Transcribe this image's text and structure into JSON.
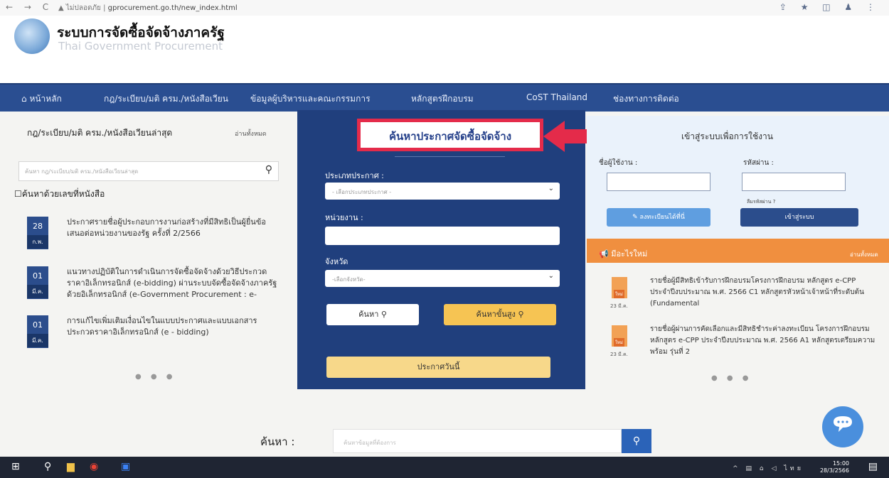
{
  "browser": {
    "nav_glyphs": "← → C",
    "lock_text": "▲ ไม่ปลอดภัย |",
    "url": "gprocurement.go.th/new_index.html",
    "toolbar_glyphs": "⇪ ★ ◫ ♟ ⋮"
  },
  "header": {
    "title": "ระบบการจัดซื้อจัดจ้างภาครัฐ",
    "subtitle": "Thai Government Procurement"
  },
  "nav": {
    "home": "หน้าหลัก",
    "laws": "กฎ/ระเบียบ/มติ ครม./หนังสือเวียน",
    "executives": "ข้อมูลผู้บริหารและคณะกรรมการ",
    "training": "หลักสูตรฝึกอบรม",
    "cost": "CoST Thailand",
    "contact": "ช่องทางการติดต่อ"
  },
  "left": {
    "title": "กฎ/ระเบียบ/มติ ครม./หนังสือเวียนล่าสุด",
    "read_all": "อ่านทั้งหมด",
    "search_placeholder": "ค้นหา กฎ/ระเบียบ/มติ ครม./หนังสือเวียนล่าสุด",
    "search_by_number": "ค้นหาด้วยเลขที่หนังสือ",
    "news": [
      {
        "day": "28",
        "month": "ก.พ.",
        "text": "ประกาศรายชื่อผู้ประกอบการงานก่อสร้างที่มีสิทธิเป็นผู้ยื่นข้อเสนอต่อหน่วยงานของรัฐ ครั้งที่ 2/2566"
      },
      {
        "day": "01",
        "month": "มี.ค.",
        "text": "แนวทางปฏิบัติในการดำเนินการจัดซื้อจัดจ้างด้วยวิธีประกวดราคาอิเล็กทรอนิกส์ (e-bidding) ผ่านระบบจัดซื้อจัดจ้างภาครัฐด้วยอิเล็กทรอนิกส์ (e-Government Procurement : e-"
      },
      {
        "day": "01",
        "month": "มี.ค.",
        "text": "การแก้ไขเพิ่มเติมเงื่อนไขในแบบประกาศและแบบเอกสารประกวดราคาอิเล็กทรอนิกส์ (e - bidding)"
      }
    ]
  },
  "center": {
    "title": "ค้นหาประกาศจัดซื้อจัดจ้าง",
    "announce_type_label": "ประเภทประกาศ :",
    "announce_type_value": "- เลือกประเภทประกาศ -",
    "agency_label": "หน่วยงาน :",
    "province_label": "จังหวัด",
    "province_value": "-เลือกจังหวัด-",
    "search_btn": "ค้นหา",
    "advanced_btn": "ค้นหาขั้นสูง",
    "today_btn": "ประกาศวันนี้"
  },
  "login": {
    "title": "เข้าสู่ระบบเพื่อการใช้งาน",
    "username_label": "ชื่อผู้ใช้งาน :",
    "password_label": "รหัสผ่าน :",
    "forgot": "ลืมรหัสผ่าน ?",
    "register_btn": "ลงทะเบียนได้ที่นี่",
    "login_btn": "เข้าสู่ระบบ"
  },
  "whatsnew": {
    "title": "มีอะไรใหม่",
    "read_all": "อ่านทั้งหมด",
    "badge": "ใหม่",
    "items": [
      {
        "date": "23 มี.ค.",
        "text": "รายชื่อผู้มีสิทธิเข้ารับการฝึกอบรมโครงการฝึกอบรม หลักสูตร e-CPP ประจำปีงบประมาณ พ.ศ. 2566 C1 หลักสูตรหัวหน้าเจ้าหน้าที่ระดับต้น (Fundamental"
      },
      {
        "date": "23 มี.ค.",
        "text": "รายชื่อผู้ผ่านการคัดเลือกและมีสิทธิชำระค่าลงทะเบียน โครงการฝึกอบรมหลักสูตร e-CPP ประจำปีงบประมาณ พ.ศ. 2566 A1 หลักสูตรเตรียมความพร้อม รุ่นที่ 2"
      }
    ]
  },
  "bottom_search": {
    "label": "ค้นหา :",
    "placeholder": "ค้นหาข้อมูลที่ต้องการ"
  },
  "taskbar": {
    "time": "15:00",
    "date": "28/3/2566",
    "tray_lang": "ไทย"
  },
  "colors": {
    "nav_bg": "#2a4e91",
    "panel_bg": "#203f7d",
    "highlight": "#e42b4a",
    "orange": "#f08f3f",
    "yellow_btn": "#f6c453"
  }
}
